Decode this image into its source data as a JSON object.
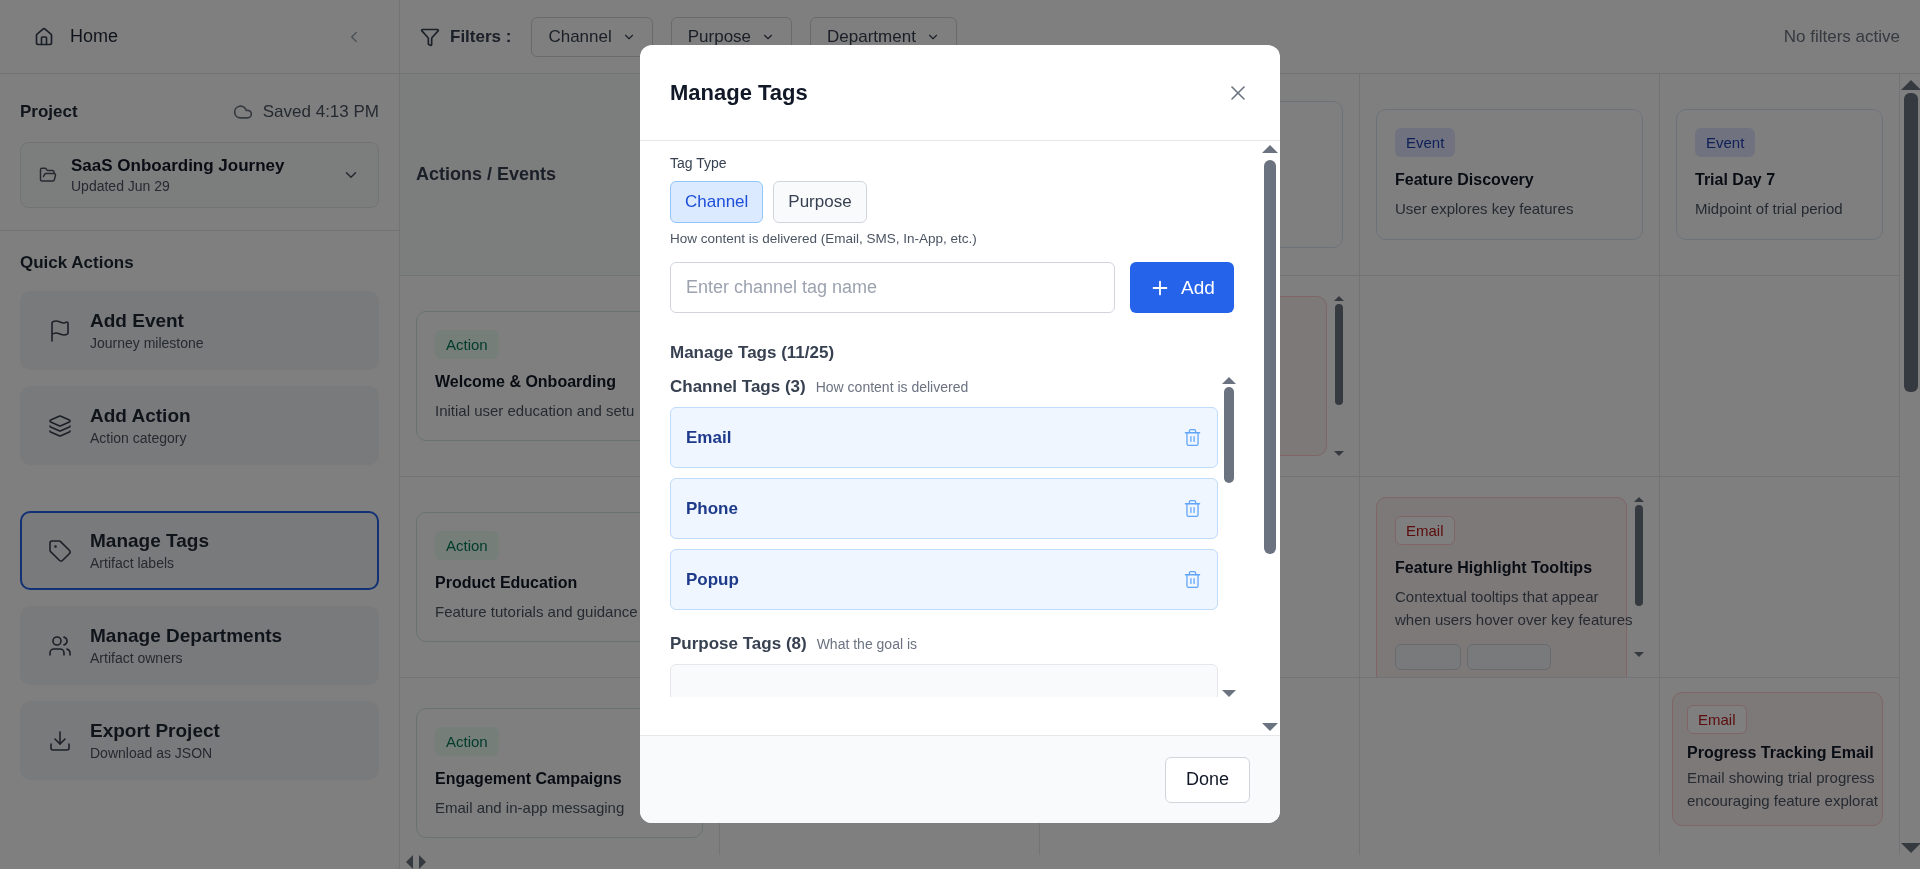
{
  "sidebar": {
    "home": "Home",
    "project_label": "Project",
    "saved": "Saved 4:13 PM",
    "project": {
      "name": "SaaS Onboarding Journey",
      "updated": "Updated Jun 29"
    },
    "quick_actions_title": "Quick Actions",
    "actions": [
      {
        "kind": "flag",
        "title": "Add Event",
        "subtitle": "Journey milestone",
        "selected": false
      },
      {
        "kind": "layers",
        "title": "Add Action",
        "subtitle": "Action category",
        "selected": false
      },
      {
        "kind": "tag",
        "title": "Manage Tags",
        "subtitle": "Artifact labels",
        "selected": true
      },
      {
        "kind": "users",
        "title": "Manage Departments",
        "subtitle": "Artifact owners",
        "selected": false
      },
      {
        "kind": "download",
        "title": "Export Project",
        "subtitle": "Download as JSON",
        "selected": false
      }
    ]
  },
  "filters": {
    "label": "Filters :",
    "dropdowns": [
      "Channel",
      "Purpose",
      "Department"
    ],
    "status": "No filters active"
  },
  "board": {
    "rows": [
      {
        "label": {
          "kind": "title",
          "title": "Actions / Events"
        },
        "cells": [
          {
            "kind": "empty"
          },
          {
            "kind": "blank-event"
          },
          {
            "kind": "event",
            "badge": "Event",
            "title": "Feature Discovery",
            "lines": [
              "User explores key features"
            ]
          },
          {
            "kind": "event",
            "badge": "Event",
            "title": "Trial Day 7",
            "lines": [
              "Midpoint of trial period"
            ]
          }
        ]
      },
      {
        "label": {
          "kind": "action",
          "badge": "Action",
          "title": "Welcome & Onboarding",
          "lines": [
            "Initial user education and setu"
          ]
        },
        "cells": [
          {
            "kind": "empty"
          },
          {
            "kind": "blank-email"
          },
          {
            "kind": "empty"
          },
          {
            "kind": "empty"
          }
        ]
      },
      {
        "label": {
          "kind": "action",
          "badge": "Action",
          "title": "Product Education",
          "lines": [
            "Feature tutorials and guidance"
          ]
        },
        "cells": [
          {
            "kind": "empty"
          },
          {
            "kind": "empty"
          },
          {
            "kind": "email",
            "badge": "Email",
            "title": "Feature Highlight Tooltips",
            "lines": [
              "Contextual tooltips that appear",
              "when users hover over key features"
            ],
            "chips": [
              {
                "kind": "short"
              },
              {
                "kind": "long"
              }
            ]
          },
          {
            "kind": "empty"
          }
        ]
      },
      {
        "label": {
          "kind": "action",
          "badge": "Action",
          "title": "Engagement Campaigns",
          "lines": [
            "Email and in-app messaging"
          ]
        },
        "cells": [
          {
            "kind": "empty"
          },
          {
            "kind": "empty"
          },
          {
            "kind": "empty"
          },
          {
            "kind": "email",
            "badge": "Email",
            "title": "Progress Tracking Email",
            "lines": [
              "Email showing trial progress",
              "encouraging feature explorat"
            ]
          }
        ]
      }
    ]
  },
  "modal": {
    "title": "Manage Tags",
    "tag_type_label": "Tag Type",
    "tag_types": [
      {
        "label": "Channel",
        "selected": true
      },
      {
        "label": "Purpose",
        "selected": false
      }
    ],
    "help": "How content is delivered (Email, SMS, In-App, etc.)",
    "input": {
      "placeholder": "Enter channel tag name"
    },
    "add_button": "Add",
    "manage_title": "Manage Tags (11/25)",
    "groups": [
      {
        "title": "Channel Tags (3)",
        "hint": "How content is delivered",
        "tags": [
          {
            "kind": "tag",
            "name": "Email"
          },
          {
            "kind": "tag",
            "name": "Phone"
          },
          {
            "kind": "tag",
            "name": "Popup"
          }
        ]
      },
      {
        "title": "Purpose Tags (8)",
        "hint": "What the goal is",
        "tags": [
          {
            "kind": "cut"
          }
        ]
      }
    ],
    "done": "Done"
  }
}
